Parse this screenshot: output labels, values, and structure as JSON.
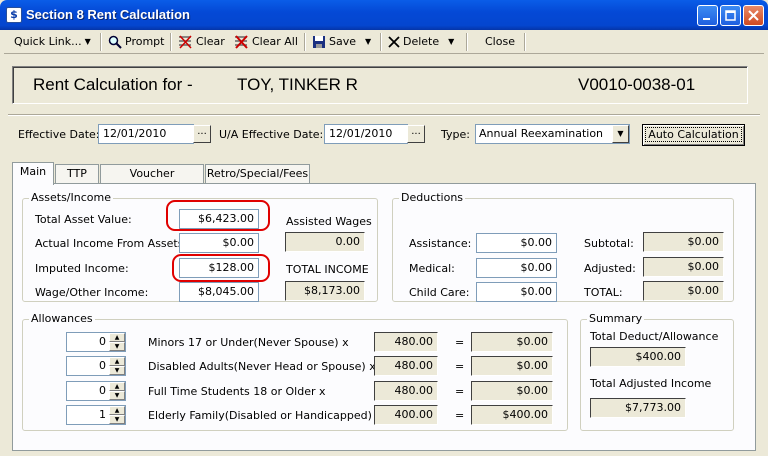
{
  "window": {
    "title": "Section 8 Rent Calculation",
    "icon": "app-icon"
  },
  "toolbar": {
    "quick_link": "Quick Link...",
    "prompt": "Prompt",
    "clear": "Clear",
    "clear_all": "Clear All",
    "save": "Save",
    "delete": "Delete",
    "close": "Close"
  },
  "header": {
    "label": "Rent Calculation for -",
    "name": "TOY, TINKER R",
    "voucher": "V0010-0038-01"
  },
  "dates": {
    "effective_label": "Effective Date:",
    "effective_value": "12/01/2010",
    "ua_label": "U/A Effective Date:",
    "ua_value": "12/01/2010",
    "type_label": "Type:",
    "type_value": "Annual Reexamination",
    "ellipsis": "...",
    "auto_calc": "Auto Calculation"
  },
  "tabs": [
    "Main",
    "TTP",
    "Voucher Calculation",
    "Retro/Special/Fees"
  ],
  "assets": {
    "title": "Assets/Income",
    "total_asset_label": "Total Asset Value:",
    "total_asset_value": "$6,423.00",
    "actual_income_label": "Actual Income From Assets:",
    "actual_income_value": "$0.00",
    "imputed_label": "Imputed Income:",
    "imputed_value": "$128.00",
    "wage_label": "Wage/Other Income:",
    "wage_value": "$8,045.00",
    "assisted_wages_label": "Assisted Wages",
    "assisted_wages_value": "0.00",
    "total_income_label": "TOTAL INCOME",
    "total_income_value": "$8,173.00"
  },
  "deductions": {
    "title": "Deductions",
    "assistance_label": "Assistance:",
    "assistance_value": "$0.00",
    "medical_label": "Medical:",
    "medical_value": "$0.00",
    "childcare_label": "Child Care:",
    "childcare_value": "$0.00",
    "subtotal_label": "Subtotal:",
    "subtotal_value": "$0.00",
    "adjusted_label": "Adjusted:",
    "adjusted_value": "$0.00",
    "total_label": "TOTAL:",
    "total_value": "$0.00"
  },
  "allowances": {
    "title": "Allowances",
    "rows": [
      {
        "count": "0",
        "label": "Minors 17 or Under(Never Spouse) x",
        "rate": "480.00",
        "eq": "=",
        "amount": "$0.00"
      },
      {
        "count": "0",
        "label": "Disabled Adults(Never Head or Spouse) x",
        "rate": "480.00",
        "eq": "=",
        "amount": "$0.00"
      },
      {
        "count": "0",
        "label": "Full Time Students 18 or Older x",
        "rate": "480.00",
        "eq": "=",
        "amount": "$0.00"
      },
      {
        "count": "1",
        "label": "Elderly Family(Disabled or Handicapped) x",
        "rate": "400.00",
        "eq": "=",
        "amount": "$400.00"
      }
    ]
  },
  "summary": {
    "title": "Summary",
    "deduct_label": "Total Deduct/Allowance",
    "deduct_value": "$400.00",
    "adjusted_income_label": "Total Adjusted Income",
    "adjusted_income_value": "$7,773.00"
  },
  "colors": {
    "titlebar": "#0449d6",
    "highlight": "#e00000",
    "background": "#ece9d8"
  }
}
